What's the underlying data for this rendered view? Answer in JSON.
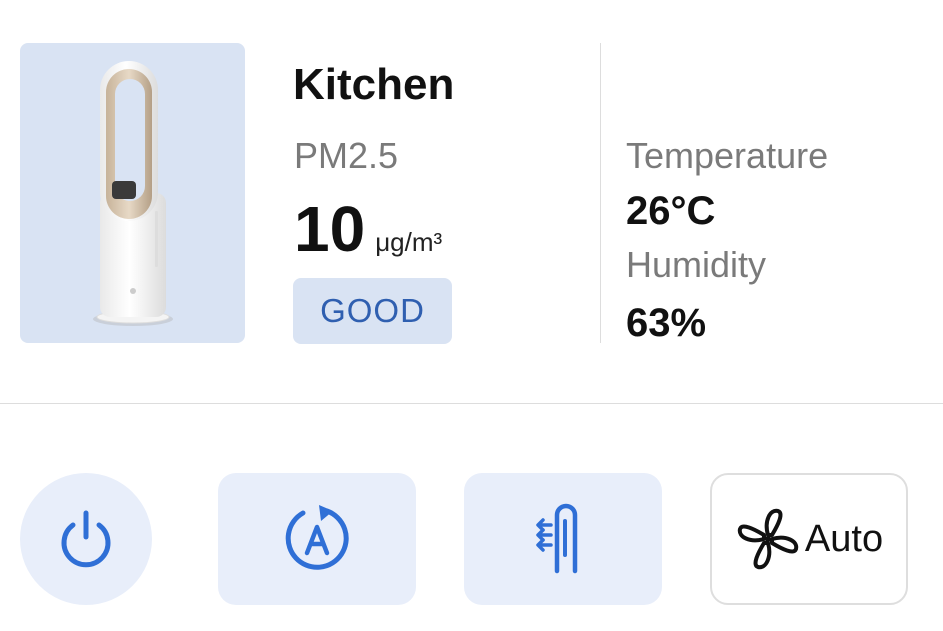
{
  "device": {
    "room_name": "Kitchen",
    "image_icon": "air-purifier-fan-tower-image"
  },
  "air_quality": {
    "label": "PM2.5",
    "value": "10",
    "unit": "μg/m³",
    "status": "GOOD"
  },
  "climate": {
    "temperature_label": "Temperature",
    "temperature_value": "26°C",
    "humidity_label": "Humidity",
    "humidity_value": "63%"
  },
  "controls": {
    "power_icon": "power-icon",
    "auto_mode_icon": "auto-mode-icon",
    "heat_mode_icon": "heat-mode-icon",
    "fan_icon": "fan-icon",
    "fan_speed_label": "Auto"
  },
  "colors": {
    "accent": "#2f6fd6",
    "tile_background": "#e8eefa",
    "badge_background": "#d9e3f3",
    "badge_text": "#2f5fb0"
  }
}
